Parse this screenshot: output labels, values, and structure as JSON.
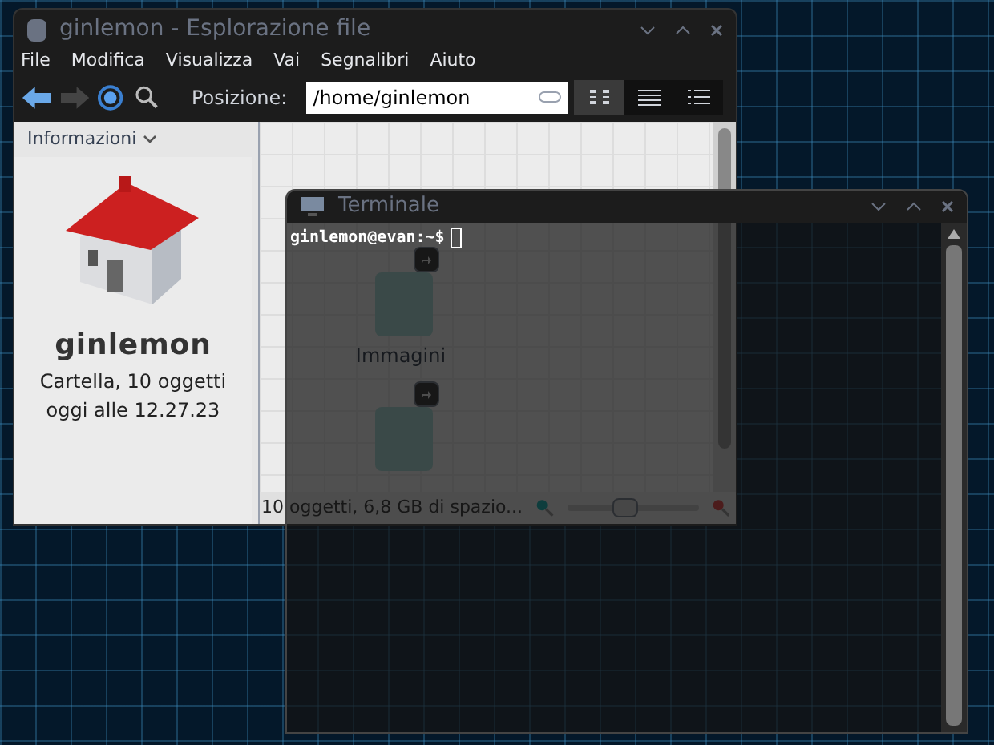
{
  "file_manager": {
    "title": "ginlemon - Esplorazione file",
    "menu": [
      {
        "label": "File"
      },
      {
        "label": "Modifica"
      },
      {
        "label": "Visualizza"
      },
      {
        "label": "Vai"
      },
      {
        "label": "Segnalibri"
      },
      {
        "label": "Aiuto"
      }
    ],
    "toolbar": {
      "location_label": "Posizione:",
      "location_value": "/home/ginlemon",
      "views": [
        {
          "kind": "icons",
          "selected": true
        },
        {
          "kind": "compact",
          "selected": false
        },
        {
          "kind": "details",
          "selected": false
        }
      ]
    },
    "panel": {
      "title": "Informazioni",
      "name": "ginlemon",
      "type": "Cartella, 10 oggetti",
      "modified": "oggi alle 12.27.23"
    },
    "files": [
      {
        "name": "Immagini"
      }
    ],
    "status": "10 oggetti, 6,8 GB di spazio...",
    "zoom": {
      "level": 0.45
    }
  },
  "terminal": {
    "title": "Terminale",
    "prompt": "ginlemon@evan:~$"
  }
}
